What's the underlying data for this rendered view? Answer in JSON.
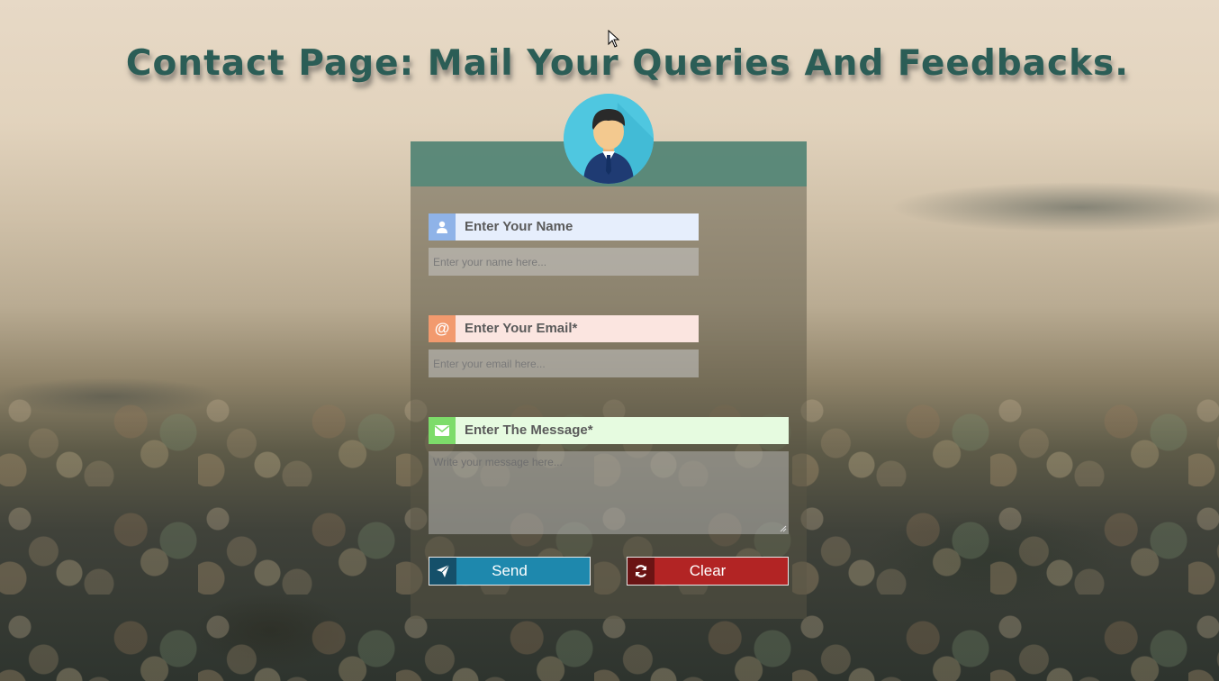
{
  "page": {
    "title": "Contact Page: Mail Your Queries And Feedbacks."
  },
  "form": {
    "name": {
      "label": "Enter Your Name",
      "placeholder": "Enter your name here...",
      "value": "",
      "icon": "user-icon",
      "accent": "#8fb3e8"
    },
    "email": {
      "label": "Enter Your Email*",
      "placeholder": "Enter your email here...",
      "value": "",
      "icon": "at-sign-icon",
      "icon_glyph": "@",
      "accent": "#f29a6e"
    },
    "message": {
      "label": "Enter The Message*",
      "placeholder": "Write your message here...",
      "value": "",
      "icon": "envelope-icon",
      "accent": "#7ddc6a"
    },
    "send_button": {
      "label": "Send",
      "icon": "paper-plane-icon",
      "color": "#1e88ad"
    },
    "clear_button": {
      "label": "Clear",
      "icon": "refresh-icon",
      "color": "#b22424"
    }
  },
  "colors": {
    "title": "#2b5d56",
    "card_header": "#50877a",
    "avatar_bg": "#4fc7e0"
  }
}
